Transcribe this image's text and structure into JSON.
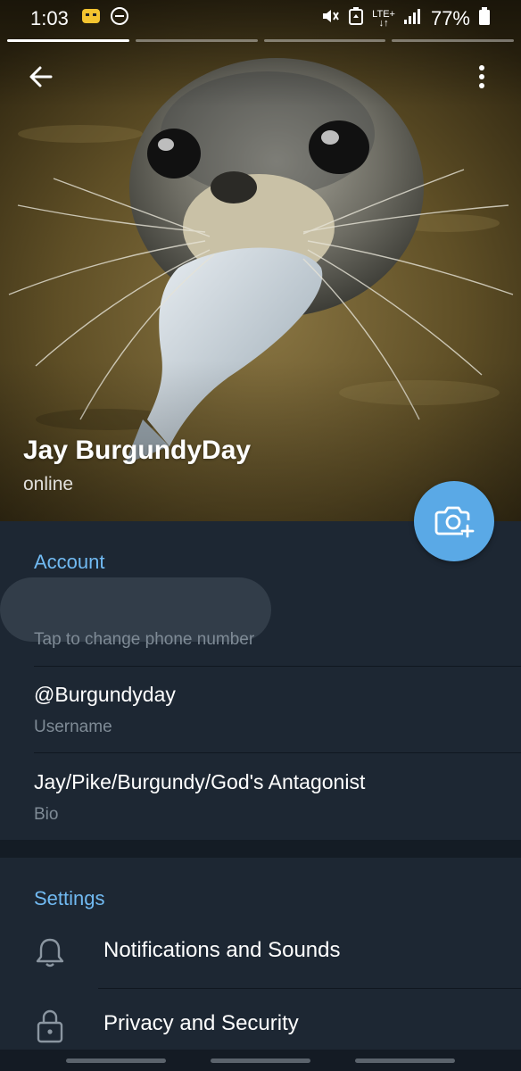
{
  "status_bar": {
    "time": "1:03",
    "battery_percent": "77%",
    "network_label": "LTE+",
    "icons": [
      "app-notification-icon",
      "do-not-disturb-icon",
      "mute-vibrate-icon",
      "battery-saver-icon",
      "lte-data-icon",
      "signal-icon",
      "battery-icon"
    ]
  },
  "story": {
    "segments": 4,
    "active_segment": 1
  },
  "header": {
    "back_icon": "arrow-left-icon",
    "more_icon": "more-vertical-icon",
    "name": "Jay BurgundyDay",
    "status": "online",
    "camera_icon": "camera-add-icon"
  },
  "account": {
    "section_title": "Account",
    "phone_hint": "Tap to change phone number",
    "username_value": "@Burgundyday",
    "username_label": "Username",
    "bio_value": "Jay/Pike/Burgundy/God's Antagonist",
    "bio_label": "Bio"
  },
  "settings": {
    "section_title": "Settings",
    "items": [
      {
        "label": "Notifications and Sounds",
        "icon": "bell-icon"
      },
      {
        "label": "Privacy and Security",
        "icon": "lock-icon"
      }
    ]
  },
  "colors": {
    "background": "#1d2733",
    "accent": "#71baf2",
    "fab": "#5aa9e6",
    "secondary_text": "#7f8b96"
  }
}
